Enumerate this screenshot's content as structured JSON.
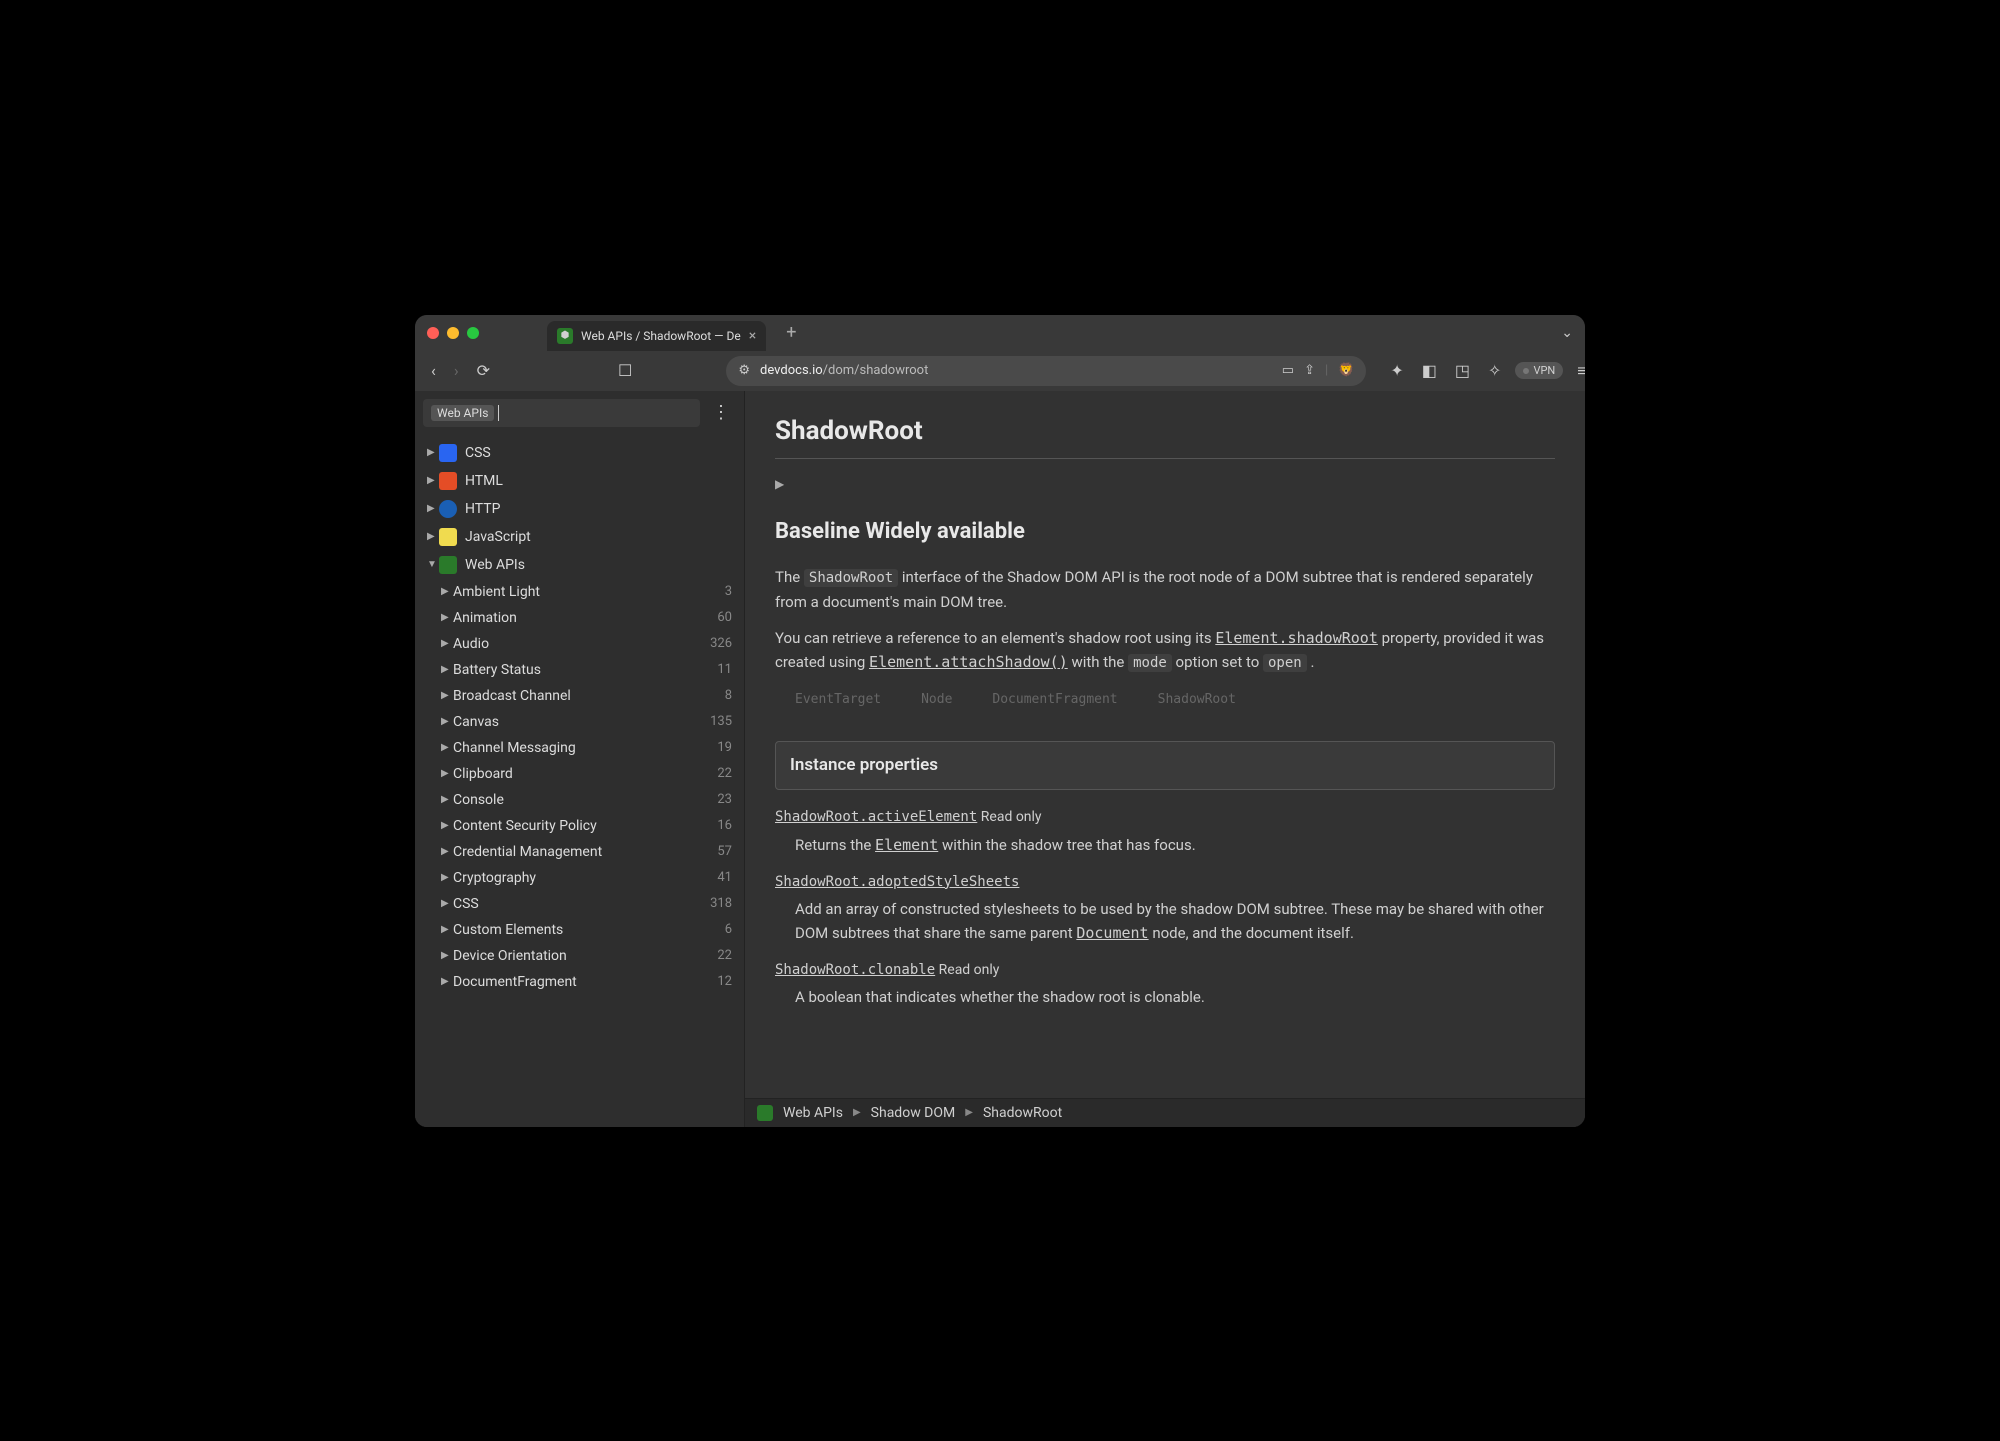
{
  "tab": {
    "title": "Web APIs / ShadowRoot — De"
  },
  "url": {
    "host": "devdocs.io",
    "path": "/dom/shadowroot"
  },
  "vpn": "VPN",
  "search": {
    "pill": "Web APIs"
  },
  "tree": {
    "top": [
      {
        "label": "CSS",
        "icon": "css"
      },
      {
        "label": "HTML",
        "icon": "html"
      },
      {
        "label": "HTTP",
        "icon": "http"
      },
      {
        "label": "JavaScript",
        "icon": "js"
      },
      {
        "label": "Web APIs",
        "icon": "api",
        "expanded": true
      }
    ],
    "sub": [
      {
        "label": "Ambient Light",
        "count": "3"
      },
      {
        "label": "Animation",
        "count": "60"
      },
      {
        "label": "Audio",
        "count": "326"
      },
      {
        "label": "Battery Status",
        "count": "11"
      },
      {
        "label": "Broadcast Channel",
        "count": "8"
      },
      {
        "label": "Canvas",
        "count": "135"
      },
      {
        "label": "Channel Messaging",
        "count": "19"
      },
      {
        "label": "Clipboard",
        "count": "22"
      },
      {
        "label": "Console",
        "count": "23"
      },
      {
        "label": "Content Security Policy",
        "count": "16"
      },
      {
        "label": "Credential Management",
        "count": "57"
      },
      {
        "label": "Cryptography",
        "count": "41"
      },
      {
        "label": "CSS",
        "count": "318"
      },
      {
        "label": "Custom Elements",
        "count": "6"
      },
      {
        "label": "Device Orientation",
        "count": "22"
      },
      {
        "label": "DocumentFragment",
        "count": "12"
      }
    ]
  },
  "doc": {
    "h1": "ShadowRoot",
    "baseline": "Baseline Widely available",
    "p1a": "The ",
    "p1code": "ShadowRoot",
    "p1b": " interface of the Shadow DOM API is the root node of a DOM subtree that is rendered separately from a document's main DOM tree.",
    "p2a": "You can retrieve a reference to an element's shadow root using its ",
    "p2link1": "Element.shadowRoot",
    "p2b": " property, provided it was created using ",
    "p2link2": "Element.attachShadow()",
    "p2c": " with the ",
    "p2code1": "mode",
    "p2d": " option set to ",
    "p2code2": "open",
    "p2e": " .",
    "chain": [
      "EventTarget",
      "Node",
      "DocumentFragment",
      "ShadowRoot"
    ],
    "section_props": "Instance properties",
    "props": [
      {
        "name": "ShadowRoot.activeElement",
        "readonly": "Read only",
        "desc_a": "Returns the ",
        "desc_link": "Element",
        "desc_b": " within the shadow tree that has focus."
      },
      {
        "name": "ShadowRoot.adoptedStyleSheets",
        "readonly": "",
        "desc_a": "Add an array of constructed stylesheets to be used by the shadow DOM subtree. These may be shared with other DOM subtrees that share the same parent ",
        "desc_link": "Document",
        "desc_b": " node, and the document itself."
      },
      {
        "name": "ShadowRoot.clonable",
        "readonly": "Read only",
        "desc_a": "A boolean that indicates whether the shadow root is clonable.",
        "desc_link": "",
        "desc_b": ""
      }
    ]
  },
  "crumbs": [
    "Web APIs",
    "Shadow DOM",
    "ShadowRoot"
  ]
}
